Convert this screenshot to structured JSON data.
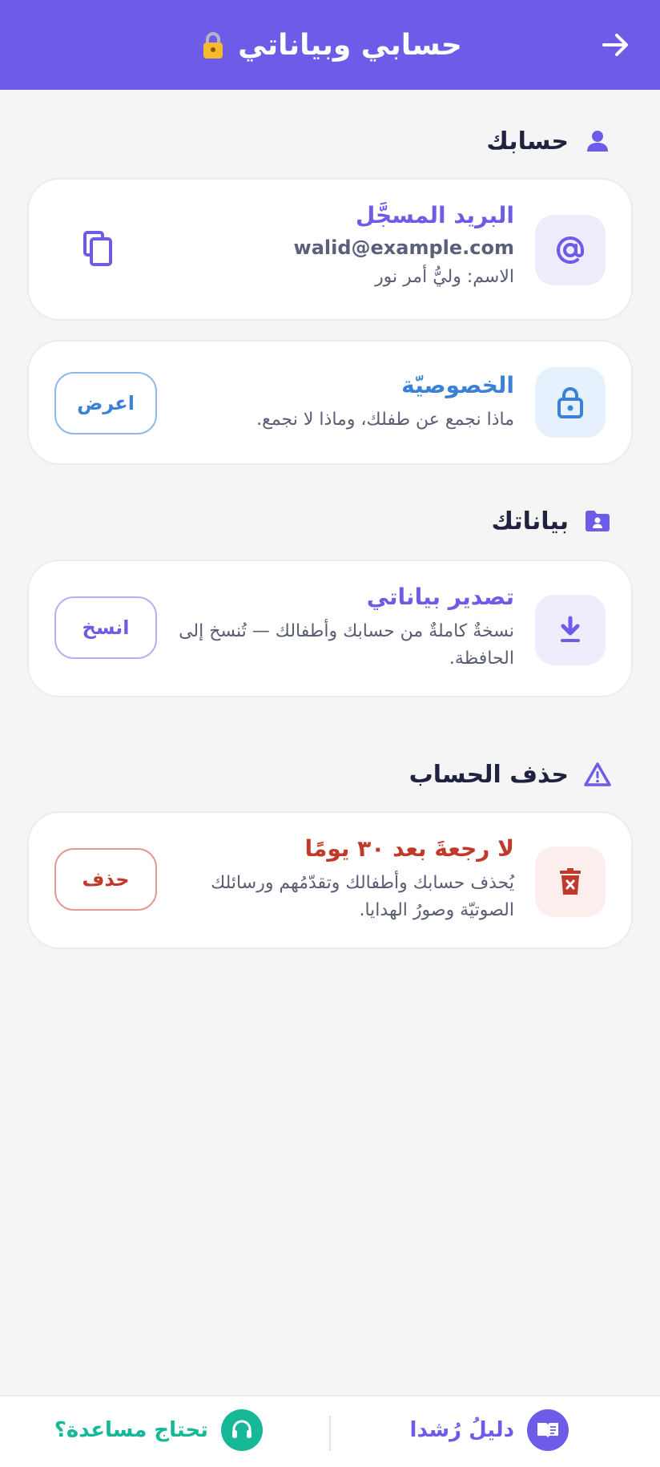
{
  "header": {
    "title": "حسابي وبياناتي"
  },
  "sections": {
    "account": "حسابك",
    "data": "بياناتك",
    "delete": "حذف الحساب"
  },
  "email_card": {
    "heading": "البريد المسجَّل",
    "email": "walid@example.com",
    "name": "الاسم: وليُّ أمر نور"
  },
  "privacy_card": {
    "heading": "الخصوصيّة",
    "description": "ماذا نجمع عن طفلك، وماذا لا نجمع.",
    "button": "اعرض"
  },
  "export_card": {
    "heading": "تصدير بياناتي",
    "description": "نسخةٌ كاملةٌ من حسابك وأطفالك — تُنسخ إلى الحافظة.",
    "button": "انسخ"
  },
  "delete_card": {
    "heading": "لا رجعةَ بعد ٣٠ يومًا",
    "description": "يُحذف حسابك وأطفالك وتقدّمُهم ورسائلك الصوتيّة وصورُ الهدايا.",
    "button": "حذف"
  },
  "bottom_bar": {
    "guide": "دليلُ رُشدا",
    "help": "تحتاج مساعدة؟"
  },
  "colors": {
    "primary": "#6c5ce7",
    "blue": "#3b82d6",
    "danger": "#c0392b",
    "teal": "#17b897"
  }
}
